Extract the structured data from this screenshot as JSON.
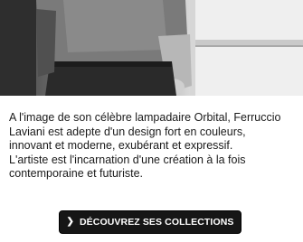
{
  "hero": {
    "image_alt": "Portrait of Ferruccio Laviani"
  },
  "description": {
    "lines": [
      "A l'image de son célèbre lampadaire Orbital, Ferruccio",
      "Laviani est adepte d'un design fort en couleurs,",
      "innovant et moderne, exubérant et expressif.",
      "L'artiste est l'incarnation d'une création à la fois",
      "contemporaine et futuriste."
    ]
  },
  "cta": {
    "label": "DÉCOUVREZ SES COLLECTIONS",
    "icon": "chevron-right-icon"
  },
  "colors": {
    "button_bg": "#161616",
    "button_text": "#ffffff",
    "text": "#1a1a1a"
  }
}
